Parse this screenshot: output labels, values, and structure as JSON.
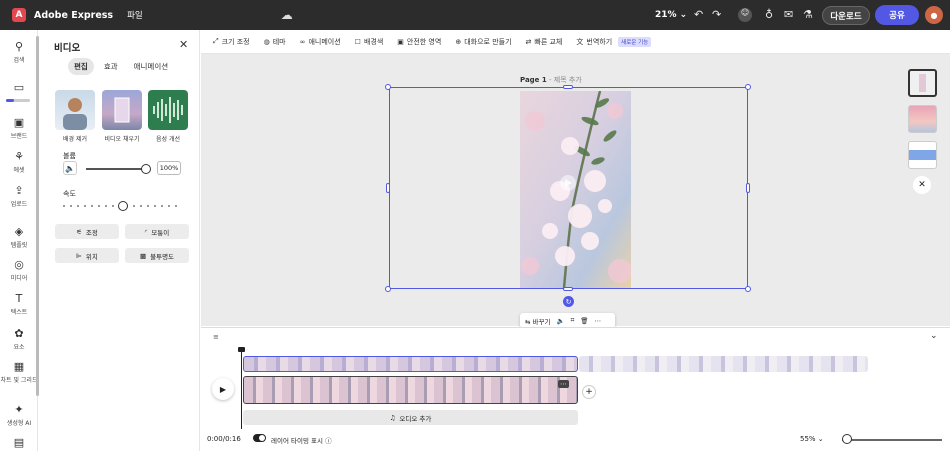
{
  "header": {
    "logo_letter": "A",
    "app_name": "Adobe Express",
    "file_menu": "파일",
    "zoom": "21%",
    "download": "다운로드",
    "share": "공유",
    "icons": [
      "cloud-icon",
      "undo-icon",
      "redo-icon",
      "user-icon",
      "lightbulb-icon",
      "comment-icon",
      "present-icon",
      "avatar"
    ]
  },
  "rail": {
    "items": [
      {
        "icon": "search-icon",
        "label": "검색"
      },
      {
        "icon": "folder-icon",
        "label": ""
      },
      {
        "icon": "brand-icon",
        "label": "브랜드"
      },
      {
        "icon": "assets-icon",
        "label": "에셋"
      },
      {
        "icon": "upload-icon",
        "label": "업로드"
      },
      {
        "icon": "template-icon",
        "label": "템플릿"
      },
      {
        "icon": "media-icon",
        "label": "미디어"
      },
      {
        "icon": "text-icon",
        "label": "텍스트"
      },
      {
        "icon": "elements-icon",
        "label": "요소"
      },
      {
        "icon": "grid-icon",
        "label": "차트 및 그리드"
      },
      {
        "icon": "ai-icon",
        "label": "생성형 AI"
      }
    ]
  },
  "panel": {
    "title": "비디오",
    "tabs": [
      "편집",
      "효과",
      "애니메이션"
    ],
    "active_tab": "편집",
    "thumbs": [
      {
        "label": "배경 제거"
      },
      {
        "label": "비디오 채우기"
      },
      {
        "label": "음성 개선"
      }
    ],
    "volume_label": "볼륨",
    "volume_value": "100%",
    "volume_level": 1.0,
    "speed_label": "속도",
    "speed_level": 0.5,
    "buttons": [
      {
        "icon": "adjust-icon",
        "label": "조정"
      },
      {
        "icon": "corner-icon",
        "label": "모퉁이"
      },
      {
        "icon": "position-icon",
        "label": "위치"
      },
      {
        "icon": "opacity-icon",
        "label": "불투명도"
      }
    ]
  },
  "toolbar": {
    "items": [
      {
        "icon": "resize-icon",
        "label": "크기 조정"
      },
      {
        "icon": "theme-icon",
        "label": "테마"
      },
      {
        "icon": "animation-icon",
        "label": "애니메이션"
      },
      {
        "icon": "background-icon",
        "label": "배경색"
      },
      {
        "icon": "safe-area-icon",
        "label": "안전한 영역"
      },
      {
        "icon": "chat-icon",
        "label": "대화으로 만들기"
      },
      {
        "icon": "swap-icon",
        "label": "빠른 교체"
      },
      {
        "icon": "translate-icon",
        "label": "번역하기"
      }
    ],
    "new_badge": "새로운 기능"
  },
  "canvas": {
    "page_label": "Page 1",
    "page_title_placeholder": " - 제목 추가",
    "context_replace": "바꾸기"
  },
  "timeline": {
    "timecode": "0:00/0:16",
    "layer_toggle": "레이어 타이밍 표시",
    "zoom": "55%",
    "zoom_level": 0.05,
    "add_audio": "오디오 추가"
  }
}
